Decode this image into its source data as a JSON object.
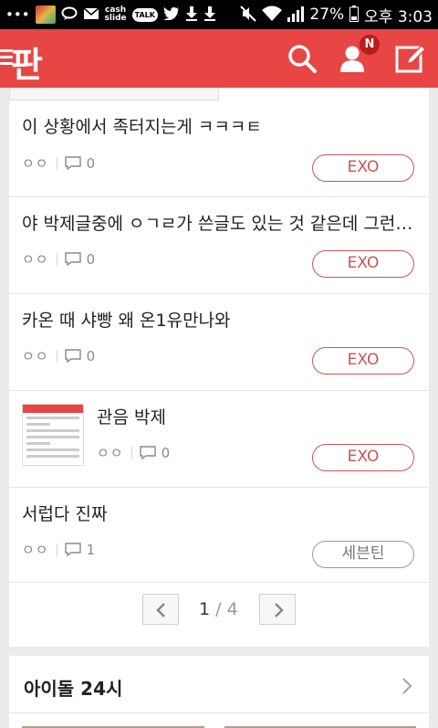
{
  "statusbar": {
    "cash_label": "cash\nslide",
    "talk_label": "TALK",
    "battery": "27%",
    "time": "오후 3:03"
  },
  "appbar": {
    "logo": "판",
    "notification_badge": "N",
    "accent_color": "#e84545"
  },
  "posts": [
    {
      "title": "이 상황에서 족터지는게 ㅋㅋㅋㅌ",
      "views": "ㅇㅇ",
      "comments": "0",
      "tag": "EXO",
      "has_thumbnail": false
    },
    {
      "title": "야 박제글중에 ㅇㄱㄹ가 쓴글도 있는 것 같은데 그런…",
      "views": "ㅇㅇ",
      "comments": "0",
      "tag": "EXO",
      "has_thumbnail": false
    },
    {
      "title": "카온 때 샤빵 왜 온1유만나와",
      "views": "ㅇㅇ",
      "comments": "0",
      "tag": "EXO",
      "has_thumbnail": false
    },
    {
      "title": "관음 박제",
      "views": "ㅇㅇ",
      "comments": "0",
      "tag": "EXO",
      "has_thumbnail": true
    },
    {
      "title": "서럽다 진짜",
      "views": "ㅇㅇ",
      "comments": "1",
      "tag": "세븐틴",
      "has_thumbnail": false
    }
  ],
  "pager": {
    "current": "1",
    "separator": "/",
    "total": "4"
  },
  "idol_section": {
    "title": "아이돌 24시"
  }
}
